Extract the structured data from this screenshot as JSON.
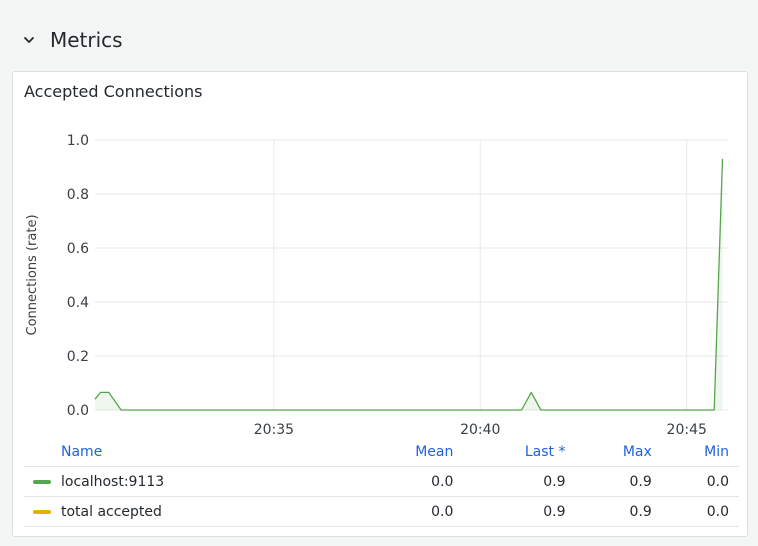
{
  "section": {
    "title": "Metrics",
    "icon": "chevron-down-icon"
  },
  "panel": {
    "title": "Accepted Connections",
    "legend": {
      "columns": [
        "Name",
        "Mean",
        "Last *",
        "Max",
        "Min"
      ],
      "rows": [
        {
          "name": "localhost:9113",
          "color": "#56a64b",
          "mean": "0.0",
          "last": "0.9",
          "max": "0.9",
          "min": "0.0"
        },
        {
          "name": "total accepted",
          "color": "#e0b400",
          "mean": "0.0",
          "last": "0.9",
          "max": "0.9",
          "min": "0.0"
        }
      ]
    }
  },
  "chart_data": {
    "type": "line",
    "ylabel": "Connections (rate)",
    "xlabel": "",
    "ylim": [
      0,
      1
    ],
    "xlim": [
      "20:30:40",
      "20:46:00"
    ],
    "yticks": [
      "0.0",
      "0.2",
      "0.4",
      "0.6",
      "0.8",
      "1.0"
    ],
    "xticks": [
      "20:35",
      "20:40",
      "20:45"
    ],
    "grid": true,
    "series": [
      {
        "name": "localhost:9113",
        "color": "#56a64b",
        "points": [
          [
            "20:30:40",
            0.04
          ],
          [
            "20:30:48",
            0.065
          ],
          [
            "20:31:00",
            0.065
          ],
          [
            "20:31:18",
            0.0
          ],
          [
            "20:41:00",
            0.0
          ],
          [
            "20:41:14",
            0.065
          ],
          [
            "20:41:28",
            0.0
          ],
          [
            "20:45:40",
            0.0
          ],
          [
            "20:45:52",
            0.93
          ]
        ]
      }
    ]
  }
}
